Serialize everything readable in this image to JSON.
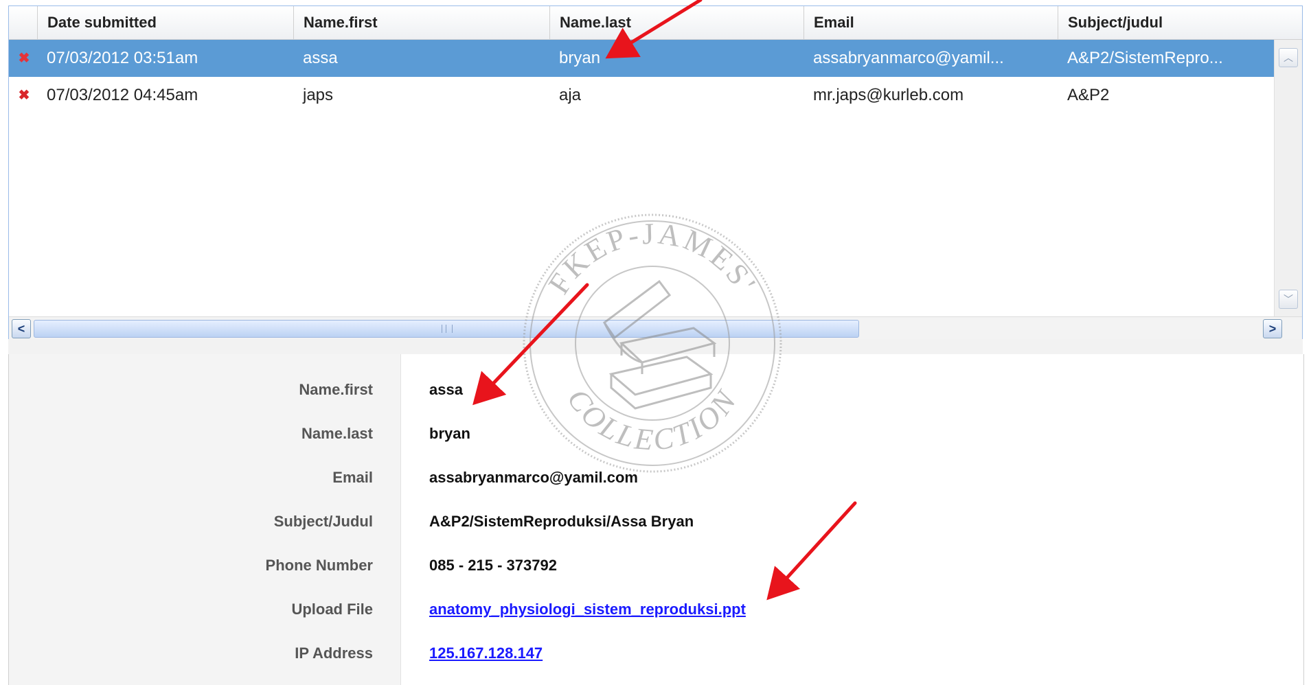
{
  "grid": {
    "columns": [
      "Date submitted",
      "Name.first",
      "Name.last",
      "Email",
      "Subject/judul"
    ],
    "rows": [
      {
        "selected": true,
        "date": "07/03/2012 03:51am",
        "first": "assa",
        "last": "bryan",
        "email": "assabryanmarco@yamil...",
        "subject": "A&P2/SistemRepro..."
      },
      {
        "selected": false,
        "date": "07/03/2012 04:45am",
        "first": "japs",
        "last": "aja",
        "email": "mr.japs@kurleb.com",
        "subject": "A&P2"
      }
    ],
    "delete_icon": "close-icon",
    "delete_glyph": "✖",
    "scroll_left_glyph": "<",
    "scroll_right_glyph": ">"
  },
  "detail": {
    "fields": [
      {
        "label": "Name.first",
        "value": "assa",
        "link": false
      },
      {
        "label": "Name.last",
        "value": "bryan",
        "link": false
      },
      {
        "label": "Email",
        "value": "assabryanmarco@yamil.com",
        "link": false
      },
      {
        "label": "Subject/Judul",
        "value": "A&P2/SistemReproduksi/Assa Bryan",
        "link": false
      },
      {
        "label": "Phone Number",
        "value": "085 - 215 - 373792",
        "link": false
      },
      {
        "label": "Upload File",
        "value": "anatomy_physiologi_sistem_reproduksi.ppt",
        "link": true
      },
      {
        "label": "IP Address",
        "value": "125.167.128.147",
        "link": true
      }
    ]
  },
  "watermark": {
    "top_text": "FKEP-JAMES'",
    "bottom_text": "COLLECTION"
  },
  "colors": {
    "selected_row": "#5b9bd5",
    "annotation_arrow": "#e8141c",
    "link": "#1a1aff"
  }
}
